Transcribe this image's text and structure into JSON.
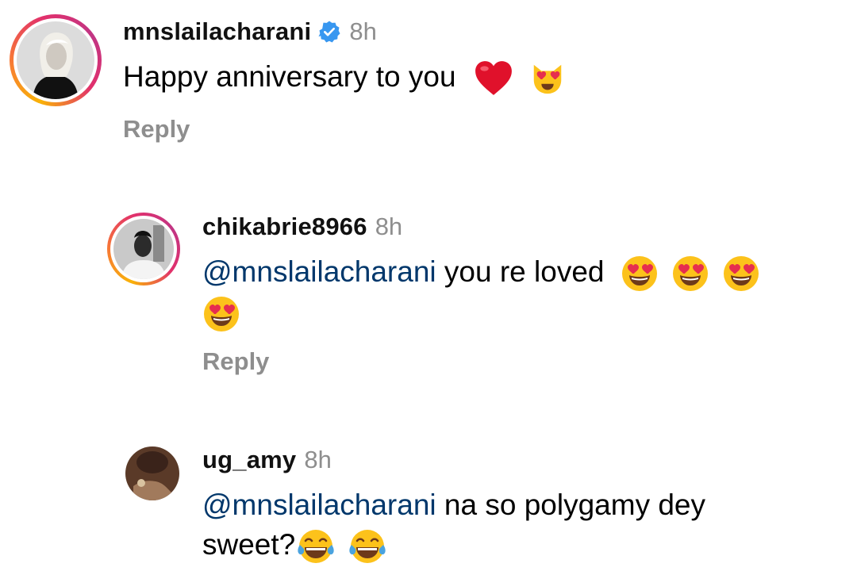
{
  "comments": [
    {
      "username": "mnslailacharani",
      "verified": true,
      "time": "8h",
      "text": "Happy anniversary to you",
      "emojis": [
        "red-heart-icon",
        "heart-eyes-cat-icon"
      ],
      "reply_label": "Reply"
    },
    {
      "username": "chikabrie8966",
      "verified": false,
      "time": "8h",
      "mention": "@mnslailacharani",
      "text": "you re loved",
      "emojis": [
        "heart-eyes-icon",
        "heart-eyes-icon",
        "heart-eyes-icon",
        "heart-eyes-icon"
      ],
      "reply_label": "Reply"
    },
    {
      "username": "ug_amy",
      "verified": false,
      "time": "8h",
      "mention": "@mnslailacharani",
      "text": "na so polygamy dey",
      "text2": "sweet?",
      "emojis": [
        "tears-of-joy-icon",
        "tears-of-joy-icon"
      ]
    }
  ],
  "colors": {
    "username": "#111111",
    "meta": "#8e8e8e",
    "mention": "#00376b",
    "verified": "#3897f0"
  }
}
